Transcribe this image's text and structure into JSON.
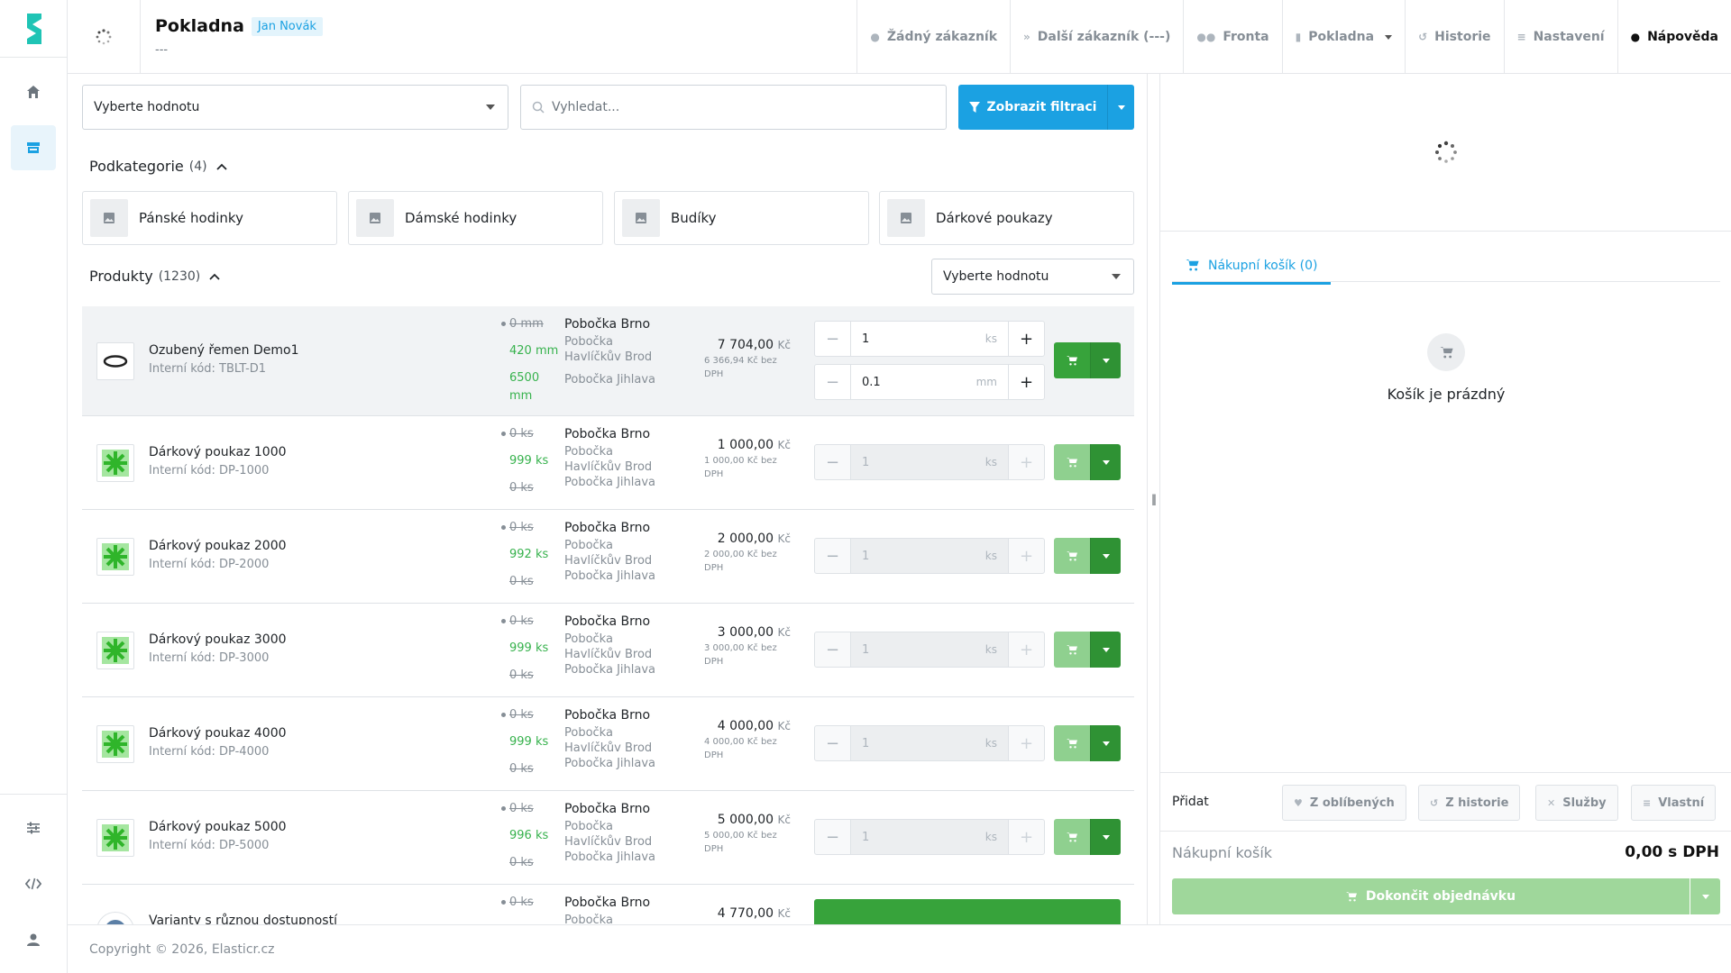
{
  "app": {
    "title": "Pokladna",
    "user": "Jan Novák",
    "subtitle": "---"
  },
  "colors": {
    "accent": "#1ba1e2",
    "success": "#37a33b",
    "muted": "#868e96"
  },
  "topnav": [
    {
      "icon": "user-icon",
      "label": "Žádný zákazník"
    },
    {
      "icon": "double-chevron-right-icon",
      "label": "Další zákazník (---)"
    },
    {
      "icon": "users-icon",
      "label": "Fronta"
    },
    {
      "icon": "register-icon",
      "label": "Pokladna"
    },
    {
      "icon": "history-icon",
      "label": "Historie"
    },
    {
      "icon": "sliders-icon",
      "label": "Nastavení"
    },
    {
      "icon": "help-icon",
      "label": "Nápověda"
    }
  ],
  "filters": {
    "select_placeholder": "Vyberte hodnotu",
    "search_placeholder": "Vyhledat...",
    "filter_button": "Zobrazit filtraci"
  },
  "subcategories": {
    "title": "Podkategorie",
    "count": "(4)",
    "items": [
      "Pánské hodinky",
      "Dámské hodinky",
      "Budíky",
      "Dárkové poukazy"
    ]
  },
  "products": {
    "title": "Produkty",
    "count": "(1230)",
    "sort_placeholder": "Vyberte hodnotu",
    "items": [
      {
        "name": "Ozubený řemen Demo1",
        "code": "Interní kód: TBLT-D1",
        "stock": [
          "0 mm",
          "420 mm",
          "6500",
          "mm"
        ],
        "branches": [
          "Pobočka Brno",
          "Pobočka",
          "Havlíčkův Brod",
          "Pobočka Jihlava"
        ],
        "price": "7 704,00",
        "currency": "Kč",
        "price_net": "6 366,94 Kč bez DPH",
        "qty1": "1",
        "unit1": "ks",
        "qty2": "0.1",
        "unit2": "mm"
      },
      {
        "name": "Dárkový poukaz 1000",
        "code": "Interní kód: DP-1000",
        "stock": [
          "0 ks",
          "999 ks",
          "0 ks"
        ],
        "branches": [
          "Pobočka Brno",
          "Pobočka",
          "Havlíčkův Brod",
          "Pobočka Jihlava"
        ],
        "price": "1 000,00",
        "currency": "Kč",
        "price_net": "1 000,00 Kč bez DPH",
        "qty1": "1",
        "unit1": "ks"
      },
      {
        "name": "Dárkový poukaz 2000",
        "code": "Interní kód: DP-2000",
        "stock": [
          "0 ks",
          "992 ks",
          "0 ks"
        ],
        "branches": [
          "Pobočka Brno",
          "Pobočka",
          "Havlíčkův Brod",
          "Pobočka Jihlava"
        ],
        "price": "2 000,00",
        "currency": "Kč",
        "price_net": "2 000,00 Kč bez DPH",
        "qty1": "1",
        "unit1": "ks"
      },
      {
        "name": "Dárkový poukaz 3000",
        "code": "Interní kód: DP-3000",
        "stock": [
          "0 ks",
          "999 ks",
          "0 ks"
        ],
        "branches": [
          "Pobočka Brno",
          "Pobočka",
          "Havlíčkův Brod",
          "Pobočka Jihlava"
        ],
        "price": "3 000,00",
        "currency": "Kč",
        "price_net": "3 000,00 Kč bez DPH",
        "qty1": "1",
        "unit1": "ks"
      },
      {
        "name": "Dárkový poukaz 4000",
        "code": "Interní kód: DP-4000",
        "stock": [
          "0 ks",
          "999 ks",
          "0 ks"
        ],
        "branches": [
          "Pobočka Brno",
          "Pobočka",
          "Havlíčkův Brod",
          "Pobočka Jihlava"
        ],
        "price": "4 000,00",
        "currency": "Kč",
        "price_net": "4 000,00 Kč bez DPH",
        "qty1": "1",
        "unit1": "ks"
      },
      {
        "name": "Dárkový poukaz 5000",
        "code": "Interní kód: DP-5000",
        "stock": [
          "0 ks",
          "996 ks",
          "0 ks"
        ],
        "branches": [
          "Pobočka Brno",
          "Pobočka",
          "Havlíčkův Brod",
          "Pobočka Jihlava"
        ],
        "price": "5 000,00",
        "currency": "Kč",
        "price_net": "5 000,00 Kč bez DPH",
        "qty1": "1",
        "unit1": "ks"
      },
      {
        "name": "Varianty s různou dostupností",
        "stock": [
          "0 ks"
        ],
        "branches": [
          "Pobočka Brno",
          "Pobočka"
        ],
        "price": "4 770,00",
        "currency": "Kč"
      }
    ]
  },
  "cart": {
    "tab": "Nákupní košík (0)",
    "empty": "Košík je prázdný",
    "add_label": "Přidat",
    "add_buttons": [
      "Z oblíbených",
      "Z historie",
      "Služby",
      "Vlastní"
    ],
    "total_label": "Nákupní košík",
    "total_value": "0,00 s DPH",
    "finish": "Dokončit objednávku"
  },
  "footer": "Copyright © 2026, Elasticr.cz"
}
